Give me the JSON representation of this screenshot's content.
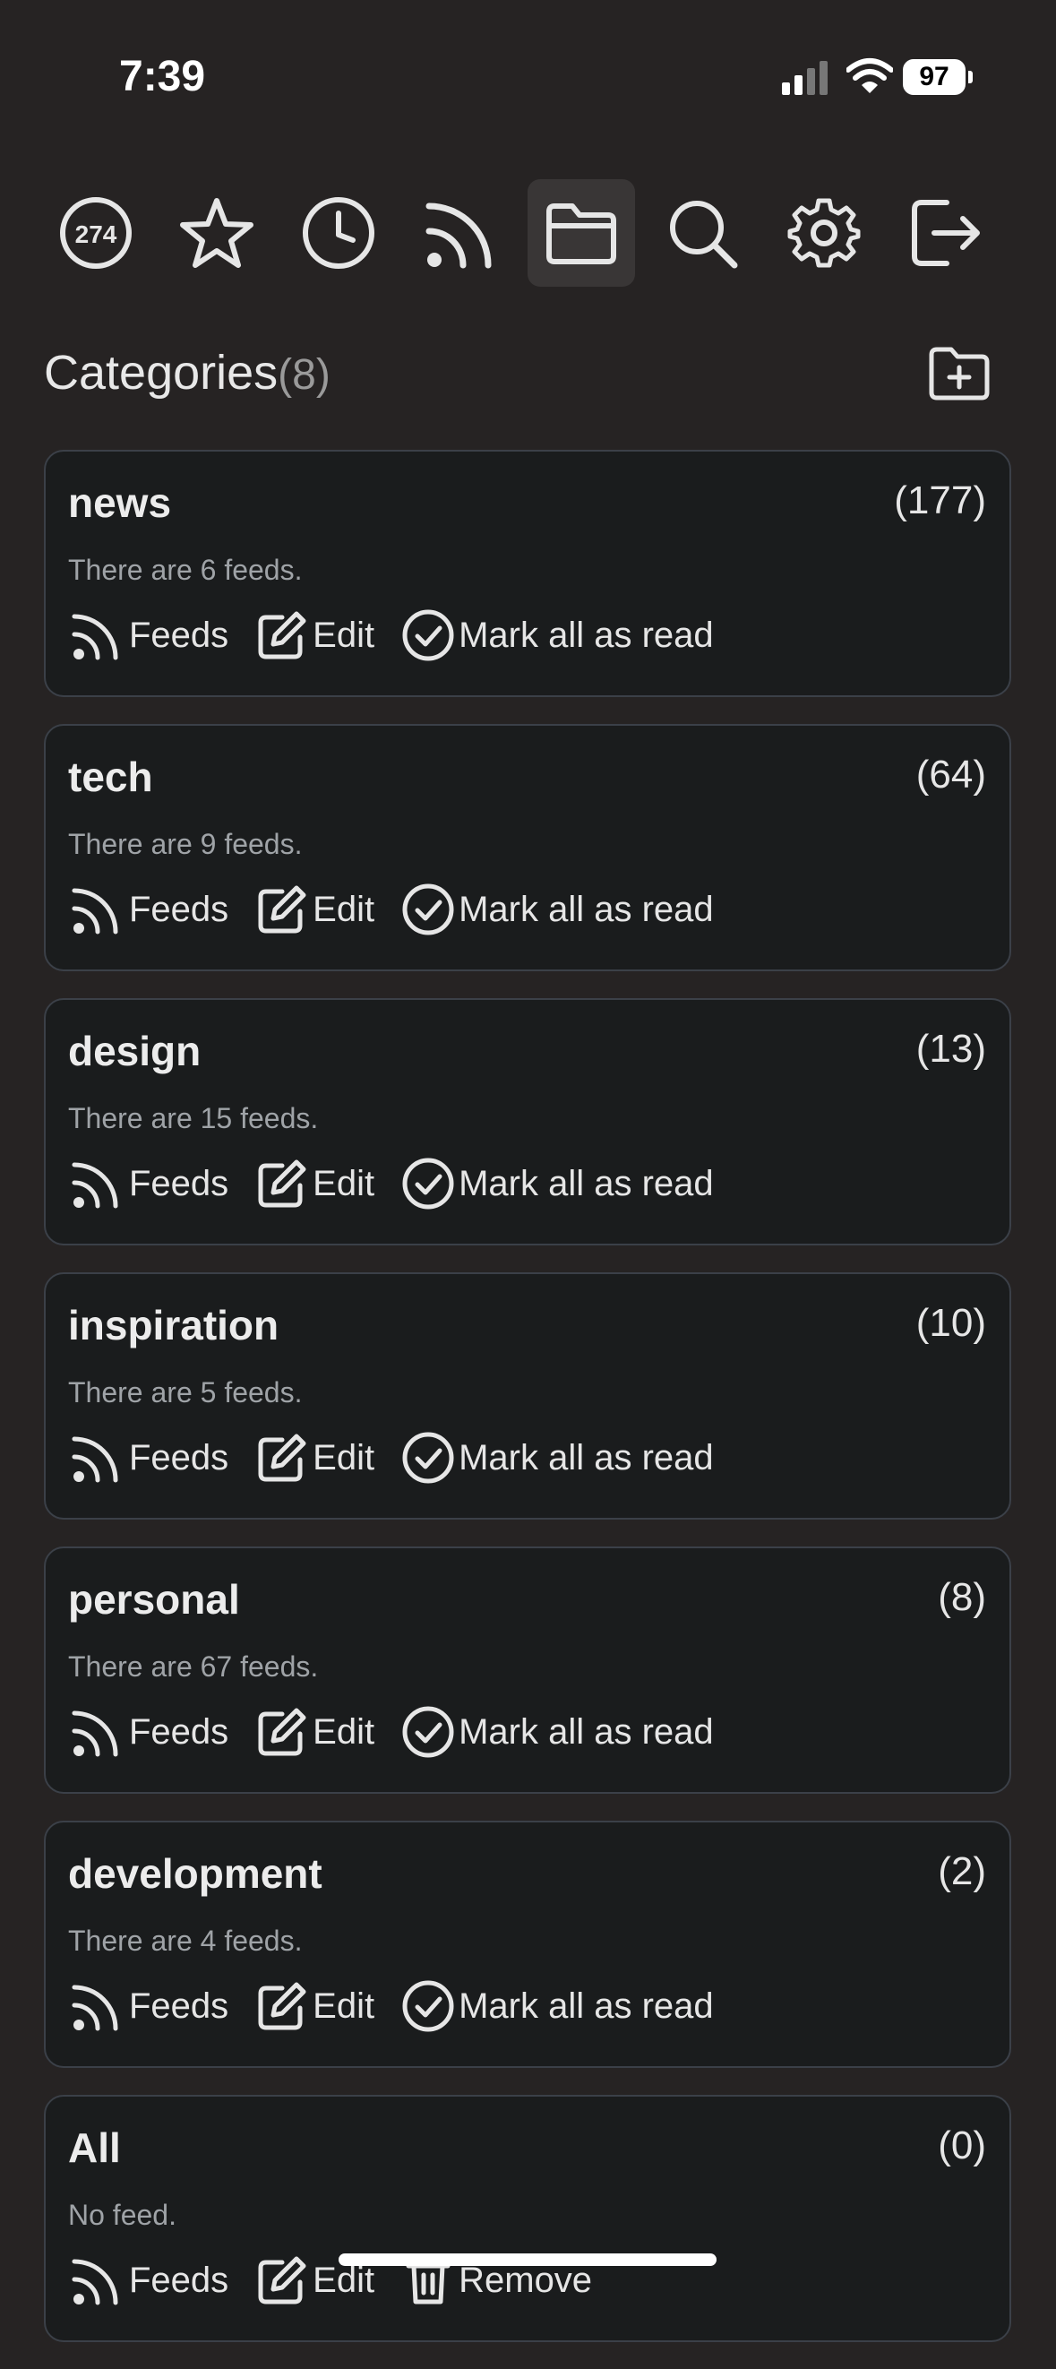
{
  "status_bar": {
    "time": "7:39",
    "battery": "97"
  },
  "toolbar": {
    "unread_count": "274",
    "items": [
      "unread-button",
      "starred-button",
      "history-button",
      "feeds-button",
      "categories-button",
      "search-button",
      "settings-button",
      "logout-button"
    ],
    "active": "categories-button"
  },
  "header": {
    "title": "Categories",
    "count": "(8)"
  },
  "categories": [
    {
      "name": "news",
      "count": "(177)",
      "desc": "There are 6 feeds.",
      "a1": "Feeds",
      "a2": "Edit",
      "a3": "Mark all as read"
    },
    {
      "name": "tech",
      "count": "(64)",
      "desc": "There are 9 feeds.",
      "a1": "Feeds",
      "a2": "Edit",
      "a3": "Mark all as read"
    },
    {
      "name": "design",
      "count": "(13)",
      "desc": "There are 15 feeds.",
      "a1": "Feeds",
      "a2": "Edit",
      "a3": "Mark all as read"
    },
    {
      "name": "inspiration",
      "count": "(10)",
      "desc": "There are 5 feeds.",
      "a1": "Feeds",
      "a2": "Edit",
      "a3": "Mark all as read"
    },
    {
      "name": "personal",
      "count": "(8)",
      "desc": "There are 67 feeds.",
      "a1": "Feeds",
      "a2": "Edit",
      "a3": "Mark all as read"
    },
    {
      "name": "development",
      "count": "(2)",
      "desc": "There are 4 feeds.",
      "a1": "Feeds",
      "a2": "Edit",
      "a3": "Mark all as read"
    },
    {
      "name": "All",
      "count": "(0)",
      "desc": "No feed.",
      "a1": "Feeds",
      "a2": "Edit",
      "a3": "Remove"
    }
  ],
  "colors": {
    "background": "#262323",
    "card": "#1a1c1d",
    "card_border": "#3b4048",
    "text": "#e6e6e6",
    "muted": "#9fa3a7"
  }
}
